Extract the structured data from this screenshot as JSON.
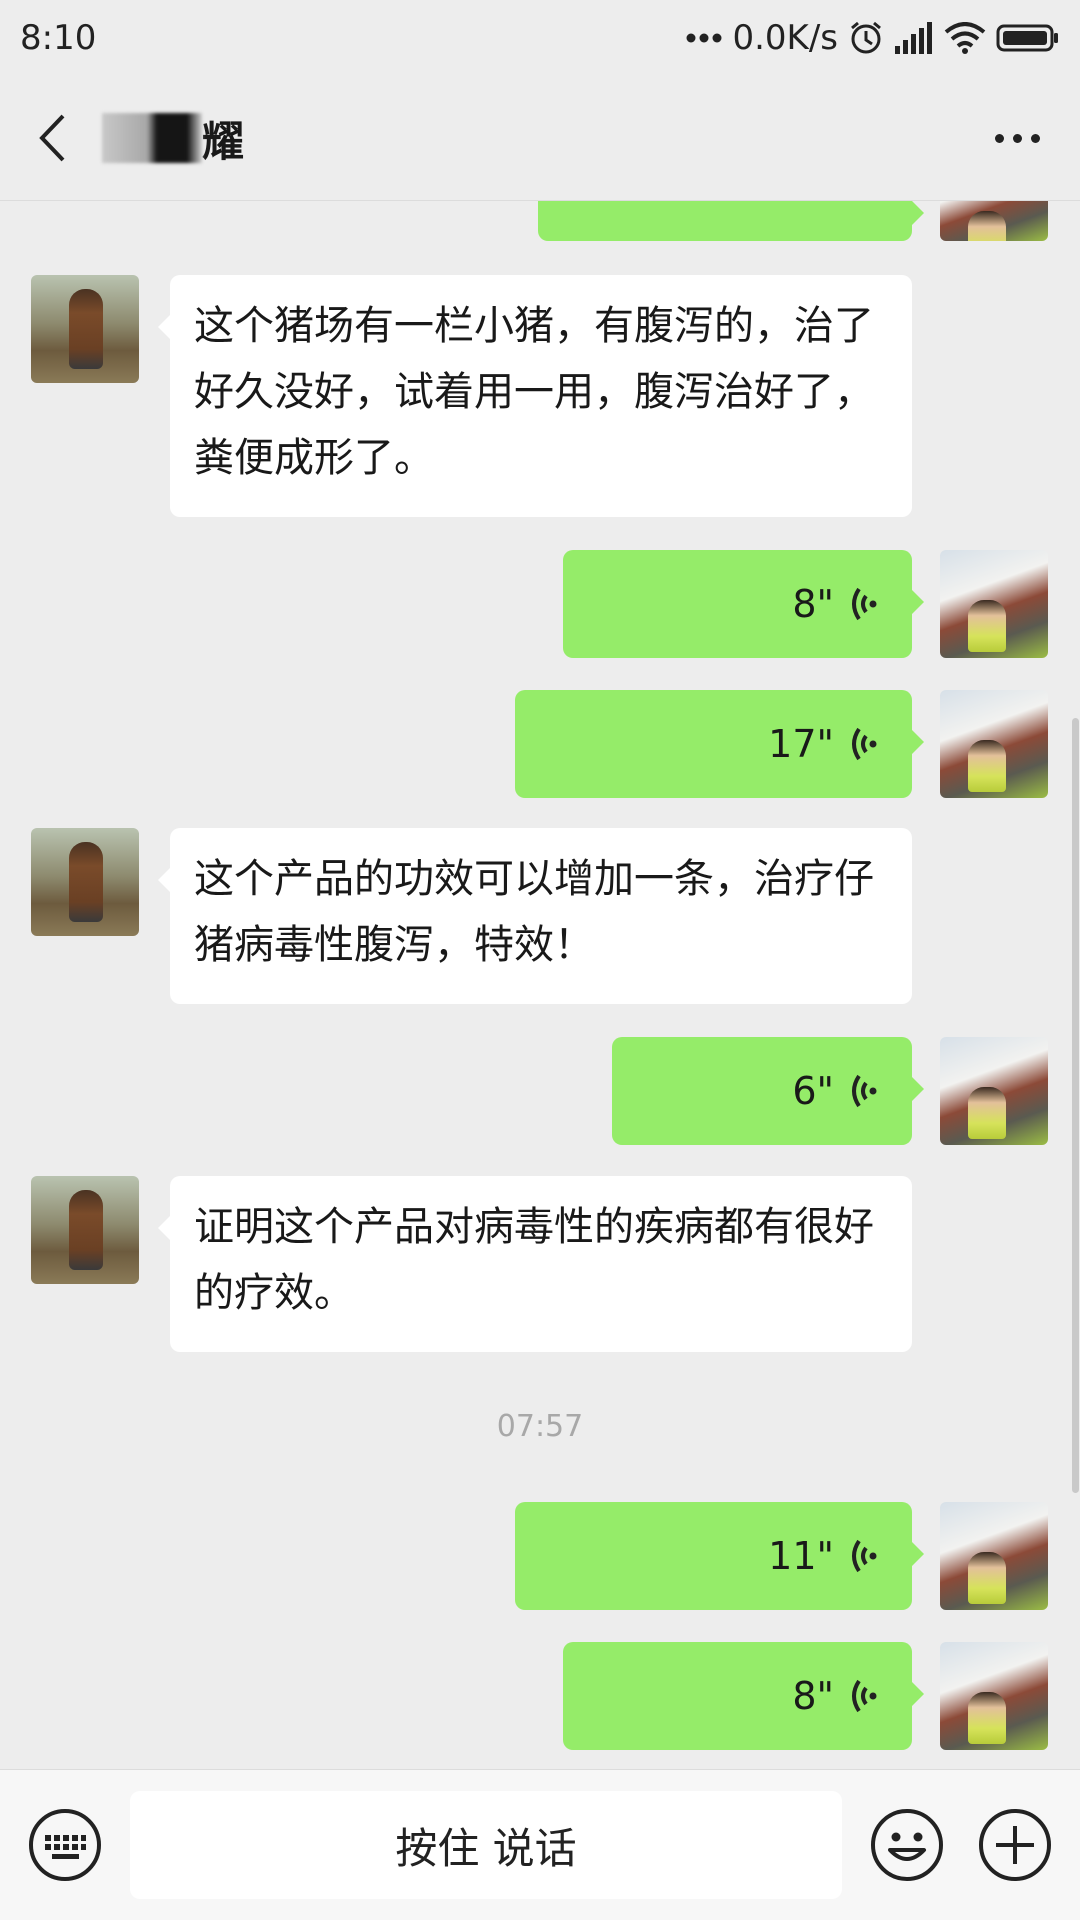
{
  "status_bar": {
    "time": "8:10",
    "network_speed": "0.0K/s",
    "icons": [
      "more-dots-icon",
      "alarm-icon",
      "signal-icon",
      "wifi-icon",
      "battery-icon"
    ]
  },
  "header": {
    "title_visible": "耀",
    "back_icon": "chevron-left-icon",
    "more_icon": "more-icon"
  },
  "messages": [
    {
      "side": "right",
      "type": "voice",
      "duration": ""
    },
    {
      "side": "left",
      "type": "text",
      "text": "这个猪场有一栏小猪，有腹泻的，治了好久没好，试着用一用，腹泻治好了，粪便成形了。"
    },
    {
      "side": "right",
      "type": "voice",
      "duration": "8\""
    },
    {
      "side": "right",
      "type": "voice",
      "duration": "17\""
    },
    {
      "side": "left",
      "type": "text",
      "text": "这个产品的功效可以增加一条，治疗仔猪病毒性腹泻，特效！"
    },
    {
      "side": "right",
      "type": "voice",
      "duration": "6\""
    },
    {
      "side": "left",
      "type": "text",
      "text": "证明这个产品对病毒性的疾病都有很好的疗效。"
    },
    {
      "type": "time",
      "text": "07:57"
    },
    {
      "side": "right",
      "type": "voice",
      "duration": "11\""
    },
    {
      "side": "right",
      "type": "voice",
      "duration": "8\""
    }
  ],
  "input_bar": {
    "hold_to_talk_label": "按住 说话",
    "icons": [
      "keyboard-icon",
      "emoji-icon",
      "plus-icon"
    ]
  },
  "colors": {
    "voice_bubble": "#95ec69",
    "background": "#ededed",
    "text_bubble": "#ffffff"
  }
}
